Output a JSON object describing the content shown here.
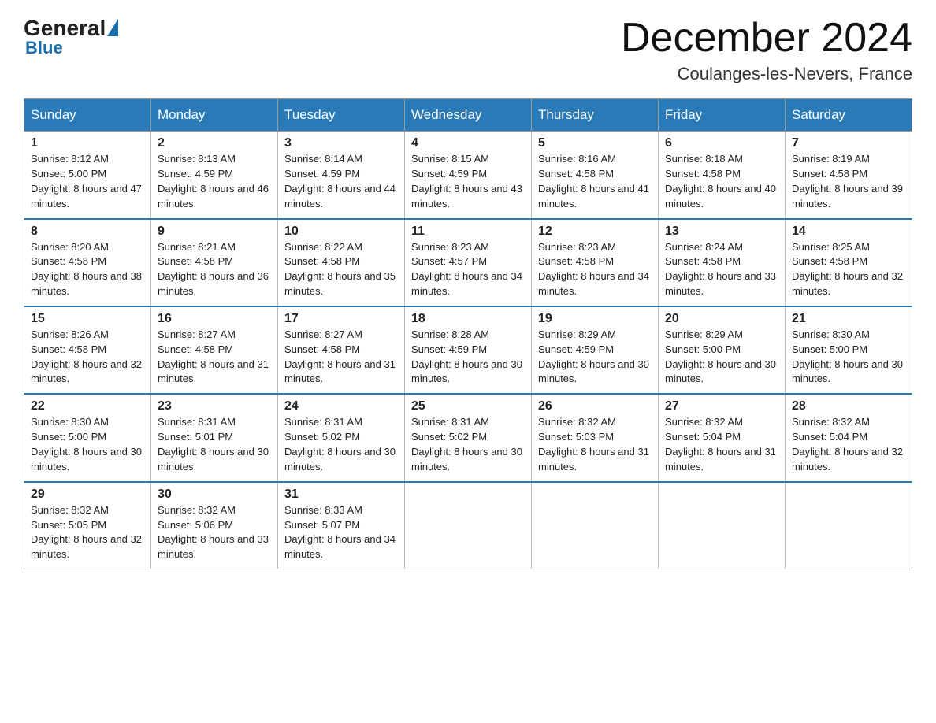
{
  "header": {
    "logo_general": "General",
    "logo_blue": "Blue",
    "month_title": "December 2024",
    "location": "Coulanges-les-Nevers, France"
  },
  "weekdays": [
    "Sunday",
    "Monday",
    "Tuesday",
    "Wednesday",
    "Thursday",
    "Friday",
    "Saturday"
  ],
  "weeks": [
    [
      {
        "num": "1",
        "rise": "8:12 AM",
        "set": "5:00 PM",
        "daylight": "8 hours and 47 minutes."
      },
      {
        "num": "2",
        "rise": "8:13 AM",
        "set": "4:59 PM",
        "daylight": "8 hours and 46 minutes."
      },
      {
        "num": "3",
        "rise": "8:14 AM",
        "set": "4:59 PM",
        "daylight": "8 hours and 44 minutes."
      },
      {
        "num": "4",
        "rise": "8:15 AM",
        "set": "4:59 PM",
        "daylight": "8 hours and 43 minutes."
      },
      {
        "num": "5",
        "rise": "8:16 AM",
        "set": "4:58 PM",
        "daylight": "8 hours and 41 minutes."
      },
      {
        "num": "6",
        "rise": "8:18 AM",
        "set": "4:58 PM",
        "daylight": "8 hours and 40 minutes."
      },
      {
        "num": "7",
        "rise": "8:19 AM",
        "set": "4:58 PM",
        "daylight": "8 hours and 39 minutes."
      }
    ],
    [
      {
        "num": "8",
        "rise": "8:20 AM",
        "set": "4:58 PM",
        "daylight": "8 hours and 38 minutes."
      },
      {
        "num": "9",
        "rise": "8:21 AM",
        "set": "4:58 PM",
        "daylight": "8 hours and 36 minutes."
      },
      {
        "num": "10",
        "rise": "8:22 AM",
        "set": "4:58 PM",
        "daylight": "8 hours and 35 minutes."
      },
      {
        "num": "11",
        "rise": "8:23 AM",
        "set": "4:57 PM",
        "daylight": "8 hours and 34 minutes."
      },
      {
        "num": "12",
        "rise": "8:23 AM",
        "set": "4:58 PM",
        "daylight": "8 hours and 34 minutes."
      },
      {
        "num": "13",
        "rise": "8:24 AM",
        "set": "4:58 PM",
        "daylight": "8 hours and 33 minutes."
      },
      {
        "num": "14",
        "rise": "8:25 AM",
        "set": "4:58 PM",
        "daylight": "8 hours and 32 minutes."
      }
    ],
    [
      {
        "num": "15",
        "rise": "8:26 AM",
        "set": "4:58 PM",
        "daylight": "8 hours and 32 minutes."
      },
      {
        "num": "16",
        "rise": "8:27 AM",
        "set": "4:58 PM",
        "daylight": "8 hours and 31 minutes."
      },
      {
        "num": "17",
        "rise": "8:27 AM",
        "set": "4:58 PM",
        "daylight": "8 hours and 31 minutes."
      },
      {
        "num": "18",
        "rise": "8:28 AM",
        "set": "4:59 PM",
        "daylight": "8 hours and 30 minutes."
      },
      {
        "num": "19",
        "rise": "8:29 AM",
        "set": "4:59 PM",
        "daylight": "8 hours and 30 minutes."
      },
      {
        "num": "20",
        "rise": "8:29 AM",
        "set": "5:00 PM",
        "daylight": "8 hours and 30 minutes."
      },
      {
        "num": "21",
        "rise": "8:30 AM",
        "set": "5:00 PM",
        "daylight": "8 hours and 30 minutes."
      }
    ],
    [
      {
        "num": "22",
        "rise": "8:30 AM",
        "set": "5:00 PM",
        "daylight": "8 hours and 30 minutes."
      },
      {
        "num": "23",
        "rise": "8:31 AM",
        "set": "5:01 PM",
        "daylight": "8 hours and 30 minutes."
      },
      {
        "num": "24",
        "rise": "8:31 AM",
        "set": "5:02 PM",
        "daylight": "8 hours and 30 minutes."
      },
      {
        "num": "25",
        "rise": "8:31 AM",
        "set": "5:02 PM",
        "daylight": "8 hours and 30 minutes."
      },
      {
        "num": "26",
        "rise": "8:32 AM",
        "set": "5:03 PM",
        "daylight": "8 hours and 31 minutes."
      },
      {
        "num": "27",
        "rise": "8:32 AM",
        "set": "5:04 PM",
        "daylight": "8 hours and 31 minutes."
      },
      {
        "num": "28",
        "rise": "8:32 AM",
        "set": "5:04 PM",
        "daylight": "8 hours and 32 minutes."
      }
    ],
    [
      {
        "num": "29",
        "rise": "8:32 AM",
        "set": "5:05 PM",
        "daylight": "8 hours and 32 minutes."
      },
      {
        "num": "30",
        "rise": "8:32 AM",
        "set": "5:06 PM",
        "daylight": "8 hours and 33 minutes."
      },
      {
        "num": "31",
        "rise": "8:33 AM",
        "set": "5:07 PM",
        "daylight": "8 hours and 34 minutes."
      },
      null,
      null,
      null,
      null
    ]
  ],
  "labels": {
    "sunrise": "Sunrise:",
    "sunset": "Sunset:",
    "daylight": "Daylight:"
  }
}
